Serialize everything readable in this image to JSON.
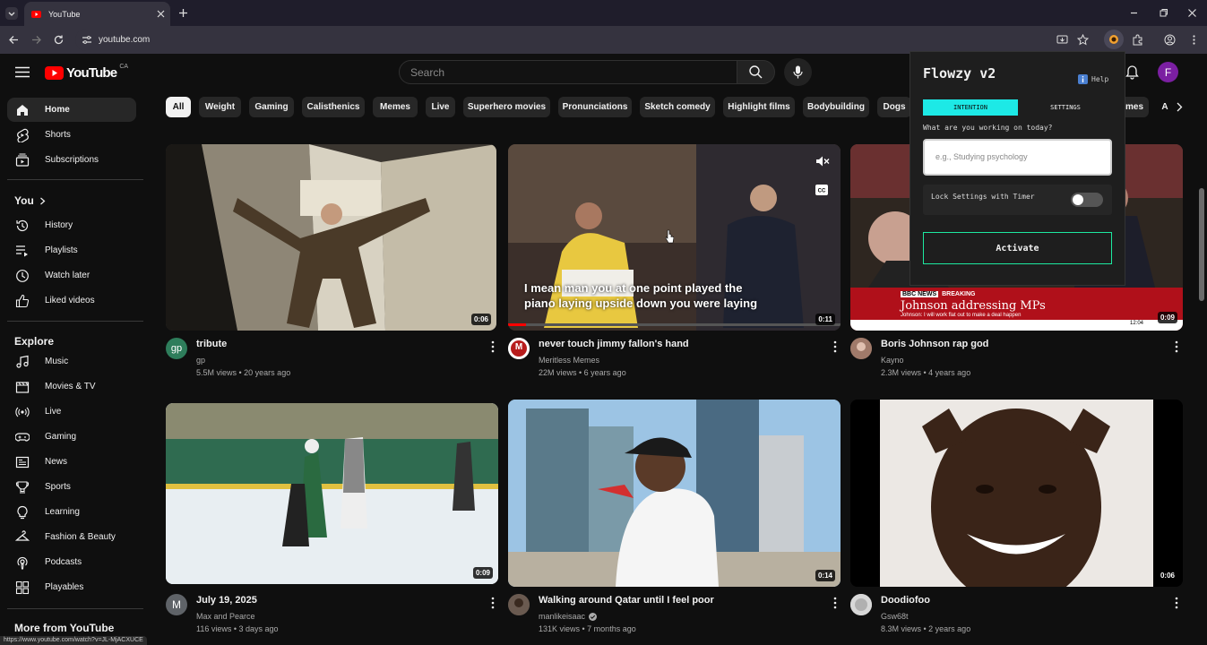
{
  "browser": {
    "tab_title": "YouTube",
    "url": "youtube.com",
    "status_url": "https://www.youtube.com/watch?v=JL-MjACXUCE"
  },
  "header": {
    "logo_text": "YouTube",
    "region": "CA",
    "search_placeholder": "Search",
    "avatar_letter": "F"
  },
  "sidebar": {
    "items_main": [
      {
        "label": "Home",
        "icon": "home-icon"
      },
      {
        "label": "Shorts",
        "icon": "shorts-icon"
      },
      {
        "label": "Subscriptions",
        "icon": "subscriptions-icon"
      }
    ],
    "you_heading": "You",
    "items_you": [
      {
        "label": "History",
        "icon": "history-icon"
      },
      {
        "label": "Playlists",
        "icon": "playlists-icon"
      },
      {
        "label": "Watch later",
        "icon": "watch-later-icon"
      },
      {
        "label": "Liked videos",
        "icon": "like-icon"
      }
    ],
    "explore_heading": "Explore",
    "items_explore": [
      {
        "label": "Music",
        "icon": "music-icon"
      },
      {
        "label": "Movies & TV",
        "icon": "movies-icon"
      },
      {
        "label": "Live",
        "icon": "live-icon"
      },
      {
        "label": "Gaming",
        "icon": "gaming-icon"
      },
      {
        "label": "News",
        "icon": "news-icon"
      },
      {
        "label": "Sports",
        "icon": "sports-icon"
      },
      {
        "label": "Learning",
        "icon": "learning-icon"
      },
      {
        "label": "Fashion & Beauty",
        "icon": "fashion-icon"
      },
      {
        "label": "Podcasts",
        "icon": "podcasts-icon"
      },
      {
        "label": "Playables",
        "icon": "playables-icon"
      }
    ],
    "more_heading": "More from YouTube"
  },
  "chips": [
    "All",
    "Weight",
    "Gaming",
    "Calisthenics",
    "Memes",
    "Live",
    "Superhero movies",
    "Pronunciations",
    "Sketch comedy",
    "Highlight films",
    "Bodybuilding",
    "Dogs",
    "mes",
    "A"
  ],
  "videos": [
    {
      "title": "tribute",
      "channel": "gp",
      "meta": "5.5M views • 20 years ago",
      "duration": "0:06",
      "avatar": "gp"
    },
    {
      "title": "never touch jimmy fallon's hand",
      "channel": "Meritless Memes",
      "meta": "22M views • 6 years ago",
      "duration": "0:11",
      "avatar": "M",
      "caption_line1": "I mean man you at one point played the",
      "caption_line2": "piano laying upside down you were laying"
    },
    {
      "title": "Boris Johnson rap god",
      "channel": "Kayno",
      "meta": "2.3M views • 4 years ago",
      "duration": "0:09",
      "avatar": "",
      "news_tag": "BBC NEWS",
      "news_breaking": "BREAKING",
      "news_headline": "Johnson addressing MPs",
      "news_sub": "Johnson: I will work flat out to make a deal happen",
      "news_time": "12:04"
    },
    {
      "title": "July 19, 2025",
      "channel": "Max and Pearce",
      "meta": "116 views • 3 days ago",
      "duration": "0:09",
      "avatar": "M"
    },
    {
      "title": "Walking around Qatar until I feel poor",
      "channel": "manlikeisaac",
      "meta": "131K views • 7 months ago",
      "duration": "0:14",
      "avatar": ""
    },
    {
      "title": "Doodiofoo",
      "channel": "Gsw68t",
      "meta": "8.3M views • 2 years ago",
      "duration": "0:06",
      "avatar": ""
    }
  ],
  "flowzy": {
    "title": "Flowzy v2",
    "help": "Help",
    "tab_intention": "INTENTION",
    "tab_settings": "SETTINGS",
    "question": "What are you working on today?",
    "placeholder": "e.g., Studying psychology",
    "lock_label": "Lock Settings with Timer",
    "activate": "Activate",
    "accent": "#1de9e6"
  }
}
